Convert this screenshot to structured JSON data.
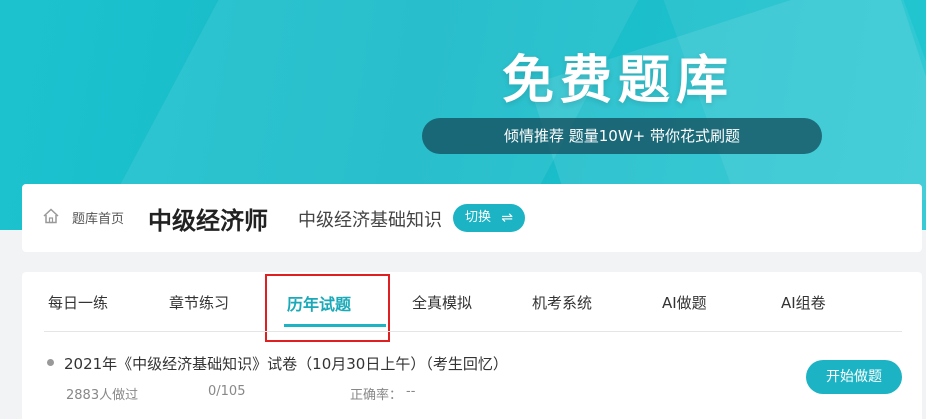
{
  "banner": {
    "title": "免费题库",
    "tagline": "倾情推荐 题量10W+ 带你花式刷题"
  },
  "course": {
    "breadcrumb_home": "题库首页",
    "title": "中级经济师",
    "subject": "中级经济基础知识",
    "switch_label": "切换",
    "switch_icon": "⇌"
  },
  "tabs": [
    {
      "label": "每日一练",
      "active": false
    },
    {
      "label": "章节练习",
      "active": false
    },
    {
      "label": "历年试题",
      "active": true
    },
    {
      "label": "全真模拟",
      "active": false
    },
    {
      "label": "机考系统",
      "active": false
    },
    {
      "label": "AI做题",
      "active": false
    },
    {
      "label": "AI组卷",
      "active": false
    }
  ],
  "papers": [
    {
      "title": "2021年《中级经济基础知识》试卷（10月30日上午）（考生回忆）",
      "participants": "2883人做过",
      "progress": "0/105",
      "accuracy_label": "正确率：",
      "accuracy_value": "--",
      "start_label": "开始做题"
    }
  ],
  "colors": {
    "accent": "#1cb4c4",
    "highlight": "#e02020"
  }
}
